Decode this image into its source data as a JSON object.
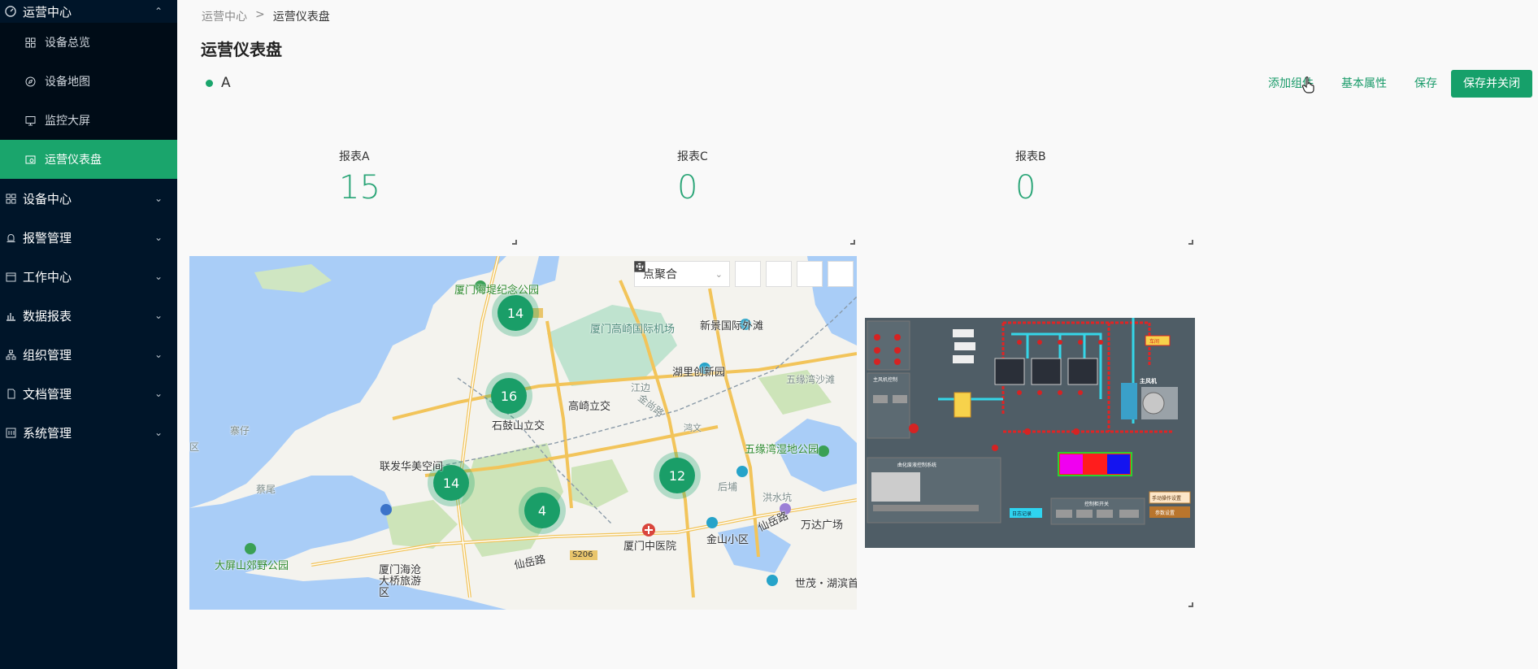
{
  "sidebar": {
    "open_group": "运营中心",
    "sub_items": [
      {
        "label": "设备总览",
        "icon": "grid-icon"
      },
      {
        "label": "设备地图",
        "icon": "compass-icon"
      },
      {
        "label": "监控大屏",
        "icon": "monitor-icon"
      },
      {
        "label": "运营仪表盘",
        "icon": "dashboard-icon",
        "active": true
      }
    ],
    "groups": [
      {
        "label": "设备中心",
        "icon": "grid-icon"
      },
      {
        "label": "报警管理",
        "icon": "alarm-icon"
      },
      {
        "label": "工作中心",
        "icon": "calendar-icon"
      },
      {
        "label": "数据报表",
        "icon": "bar-chart-icon"
      },
      {
        "label": "组织管理",
        "icon": "org-icon"
      },
      {
        "label": "文档管理",
        "icon": "document-icon"
      },
      {
        "label": "系统管理",
        "icon": "system-icon"
      }
    ]
  },
  "breadcrumb": {
    "root": "运营中心",
    "sep": ">",
    "current": "运营仪表盘"
  },
  "page": {
    "title": "运营仪表盘",
    "tab": "A"
  },
  "actions": {
    "add_component": "添加组件",
    "basic_props": "基本属性",
    "save": "保存",
    "save_close": "保存并关闭"
  },
  "stats": [
    {
      "label": "报表A",
      "value": "15"
    },
    {
      "label": "报表C",
      "value": "0"
    },
    {
      "label": "报表B",
      "value": "0"
    }
  ],
  "map": {
    "mode": "点聚合",
    "clusters": [
      "14",
      "16",
      "14",
      "4",
      "12"
    ],
    "labels": {
      "park": "厦门海堤纪念公园",
      "airport": "厦门高崎国际机场",
      "beach": "新景国际外滩",
      "lake": "湖里创新园",
      "wuyuan": "五缘湾沙滩",
      "gaoqi": "高崎立交",
      "shigu": "石鼓山立交",
      "wetland": "五缘湾湿地公园",
      "lianfa": "联发华美空间",
      "wanda": "万达广场",
      "hospital": "厦门中医院",
      "jinshan": "金山小区",
      "xianyue": "仙岳路",
      "xianyue2": "仙岳路",
      "dapingshan": "大屏山郊野公园",
      "haicang": "厦门海沧大桥旅游区",
      "shimao": "世茂・湖滨首",
      "jiangbian": "江边",
      "jinshang": "金尚路",
      "hongwen": "鸿文",
      "houbu": "后埔",
      "hongshuifeng": "洪水坑",
      "yuanwei": "寨仔",
      "quarea": "区",
      "guanzi": "蔡尾",
      "s206": "S206"
    }
  },
  "scada": {
    "title_tag": "车间",
    "pump_label": "主风机",
    "panel_control": "主风机控制",
    "panel_cure": "曲化废液控制系统",
    "panel_switch": "控制柜开关",
    "btn_manual": "手动操作设置",
    "btn_param": "参数设置",
    "btn_log": "日志记录"
  },
  "colors": {
    "accent": "#1aa56c",
    "sidebar": "#001529"
  }
}
